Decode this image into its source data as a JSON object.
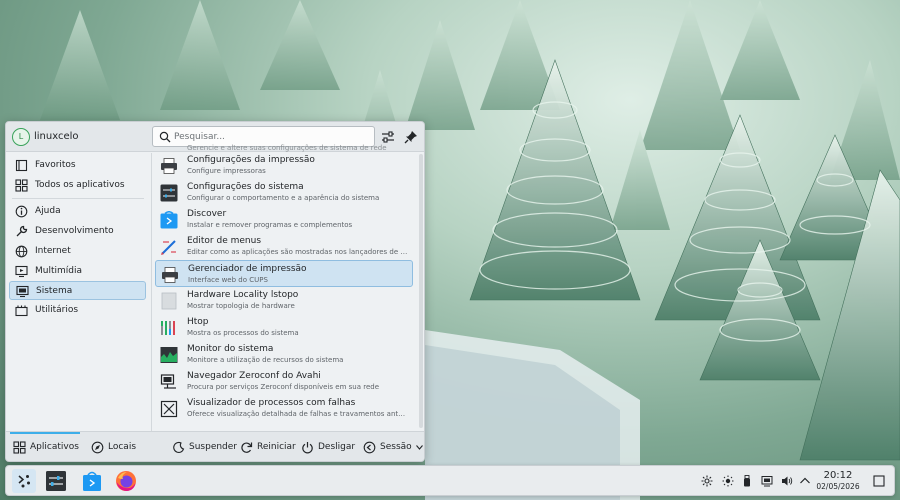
{
  "user": {
    "initial": "L",
    "name": "linuxcelo"
  },
  "search": {
    "placeholder": "Pesquisar..."
  },
  "header_buttons": [
    {
      "icon": "configure-icon"
    },
    {
      "icon": "pin-icon"
    }
  ],
  "sidebar": {
    "items": [
      {
        "label": "Favoritos",
        "icon": "bookmark-icon"
      },
      {
        "label": "Todos os aplicativos",
        "icon": "grid-icon"
      },
      {
        "label": "Ajuda",
        "icon": "info-icon"
      },
      {
        "label": "Desenvolvimento",
        "icon": "wrench-icon"
      },
      {
        "label": "Internet",
        "icon": "globe-icon"
      },
      {
        "label": "Multimídia",
        "icon": "monitor-icon"
      },
      {
        "label": "Sistema",
        "icon": "system-icon",
        "active": true
      },
      {
        "label": "Utilitários",
        "icon": "utilities-icon"
      }
    ]
  },
  "apps": {
    "partial_desc": "Gerencie e altere suas configurações de sistema de rede",
    "items": [
      {
        "name": "Configurações da impressão",
        "desc": "Configure impressoras",
        "icon": "printer-icon"
      },
      {
        "name": "Configurações do sistema",
        "desc": "Configurar o comportamento e a aparência do sistema",
        "icon": "system-settings-icon"
      },
      {
        "name": "Discover",
        "desc": "Instalar e remover programas e complementos",
        "icon": "discover-icon"
      },
      {
        "name": "Editor de menus",
        "desc": "Editar como as aplicações são mostradas nos lançadores de ap...",
        "icon": "menu-editor-icon"
      },
      {
        "name": "Gerenciador de impressão",
        "desc": "Interface web do CUPS",
        "icon": "printer-icon",
        "active": true
      },
      {
        "name": "Hardware Locality lstopo",
        "desc": "Mostrar topologia de hardware",
        "icon": "hardware-icon"
      },
      {
        "name": "Htop",
        "desc": "Mostra os processos do sistema",
        "icon": "htop-icon"
      },
      {
        "name": "Monitor do sistema",
        "desc": "Monitore a utilização de recursos do sistema",
        "icon": "system-monitor-icon"
      },
      {
        "name": "Navegador Zeroconf do Avahi",
        "desc": "Procura por serviços Zeroconf disponíveis em sua rede",
        "icon": "network-browser-icon"
      },
      {
        "name": "Visualizador de processos com falhas",
        "desc": "Oferece visualização detalhada de falhas e travamentos anteri...",
        "icon": "crash-viewer-icon"
      }
    ]
  },
  "footer": {
    "tabs": [
      {
        "label": "Aplicativos",
        "icon": "apps-icon",
        "active": true
      },
      {
        "label": "Locais",
        "icon": "places-icon"
      }
    ],
    "actions": [
      {
        "label": "Suspender",
        "icon": "suspend-icon"
      },
      {
        "label": "Reiniciar",
        "icon": "restart-icon"
      },
      {
        "label": "Desligar",
        "icon": "shutdown-icon"
      },
      {
        "label": "Sessão",
        "icon": "session-icon"
      }
    ]
  },
  "taskbar": {
    "launchers": [
      {
        "icon": "kickoff-icon",
        "active": true
      },
      {
        "icon": "system-settings-icon"
      },
      {
        "icon": "discover-icon"
      },
      {
        "icon": "firefox-icon"
      }
    ],
    "tray": [
      "settings-icon",
      "brightness-icon",
      "usb-icon",
      "clipboard-icon",
      "volume-icon",
      "network-icon",
      "expand-tray-icon"
    ],
    "clock": {
      "time": "20:12",
      "date": "02/05/2026"
    }
  },
  "colors": {
    "accent": "#3daee9",
    "selection": "#cfe3f2",
    "panel": "#eef1f3",
    "wallpaper_green": "#7fa893"
  }
}
